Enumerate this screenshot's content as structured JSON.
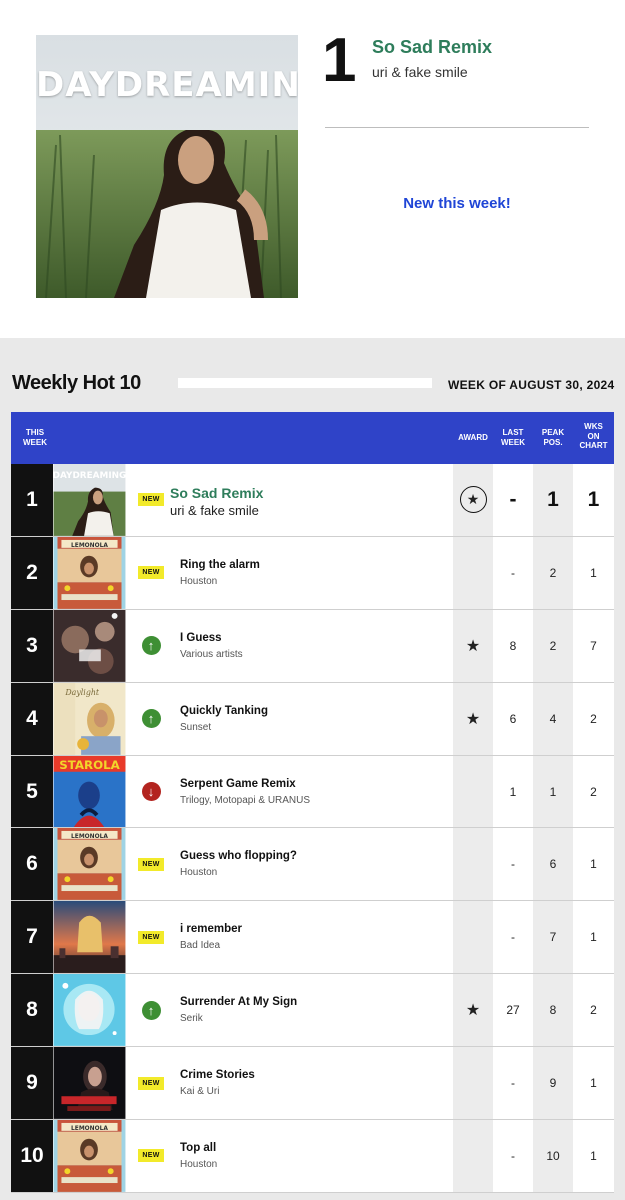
{
  "hero": {
    "rank": "1",
    "title": "So Sad Remix",
    "artist": "uri & fake smile",
    "cover_text": "DAYDREAMING",
    "badge": "New this week!"
  },
  "chart": {
    "heading": "Weekly Hot 10",
    "week": "WEEK OF AUGUST 30, 2024",
    "columns": {
      "this_week_1": "THIS",
      "this_week_2": "WEEK",
      "award": "AWARD",
      "last_week_1": "LAST",
      "last_week_2": "WEEK",
      "peak_1": "PEAK",
      "peak_2": "POS.",
      "wks_1": "WKS",
      "wks_2": "ON",
      "wks_3": "CHART"
    },
    "rows": [
      {
        "rank": "1",
        "title": "So Sad Remix",
        "artist": "uri & fake smile",
        "trend": "new",
        "new_label": "NEW",
        "award": "circle-star",
        "award_symbol": "★",
        "last": "-",
        "peak": "1",
        "weeks": "1",
        "cover": "daydreaming"
      },
      {
        "rank": "2",
        "title": "Ring the alarm",
        "artist": "Houston",
        "trend": "new",
        "new_label": "NEW",
        "award": "",
        "award_symbol": "",
        "last": "-",
        "peak": "2",
        "weeks": "1",
        "cover": "lemonola"
      },
      {
        "rank": "3",
        "title": "I Guess",
        "artist": "Various artists",
        "trend": "up",
        "new_label": "",
        "award": "star",
        "award_symbol": "★",
        "last": "8",
        "peak": "2",
        "weeks": "7",
        "cover": "dark-collage"
      },
      {
        "rank": "4",
        "title": "Quickly Tanking",
        "artist": "Sunset",
        "trend": "up",
        "new_label": "",
        "award": "star",
        "award_symbol": "★",
        "last": "6",
        "peak": "4",
        "weeks": "2",
        "cover": "daylight"
      },
      {
        "rank": "5",
        "title": "Serpent Game Remix",
        "artist": "Trilogy, Motopapi & URANUS",
        "trend": "down",
        "new_label": "",
        "award": "",
        "award_symbol": "",
        "last": "1",
        "peak": "1",
        "weeks": "2",
        "cover": "starola"
      },
      {
        "rank": "6",
        "title": "Guess who flopping?",
        "artist": "Houston",
        "trend": "new",
        "new_label": "NEW",
        "award": "",
        "award_symbol": "",
        "last": "-",
        "peak": "6",
        "weeks": "1",
        "cover": "lemonola"
      },
      {
        "rank": "7",
        "title": "i remember",
        "artist": "Bad Idea",
        "trend": "new",
        "new_label": "NEW",
        "award": "",
        "award_symbol": "",
        "last": "-",
        "peak": "7",
        "weeks": "1",
        "cover": "sunset-city"
      },
      {
        "rank": "8",
        "title": "Surrender At My Sign",
        "artist": "Serik",
        "trend": "up",
        "new_label": "",
        "award": "star",
        "award_symbol": "★",
        "last": "27",
        "peak": "8",
        "weeks": "2",
        "cover": "blue-glow"
      },
      {
        "rank": "9",
        "title": "Crime Stories",
        "artist": "Kai & Uri",
        "trend": "new",
        "new_label": "NEW",
        "award": "",
        "award_symbol": "",
        "last": "-",
        "peak": "9",
        "weeks": "1",
        "cover": "dark-red"
      },
      {
        "rank": "10",
        "title": "Top all",
        "artist": "Houston",
        "trend": "new",
        "new_label": "NEW",
        "award": "",
        "award_symbol": "",
        "last": "-",
        "peak": "10",
        "weeks": "1",
        "cover": "lemonola"
      }
    ]
  },
  "icons": {
    "up": "arrow-up-icon",
    "down": "arrow-down-icon",
    "award": "star-icon"
  },
  "colors": {
    "header_blue": "#2f43c8",
    "title_green": "#2e7d5b",
    "new_badge_yellow": "#f2ea2a",
    "trend_up": "#3e8f34",
    "trend_down": "#b3241f",
    "hero_badge_blue": "#1f45d6"
  }
}
